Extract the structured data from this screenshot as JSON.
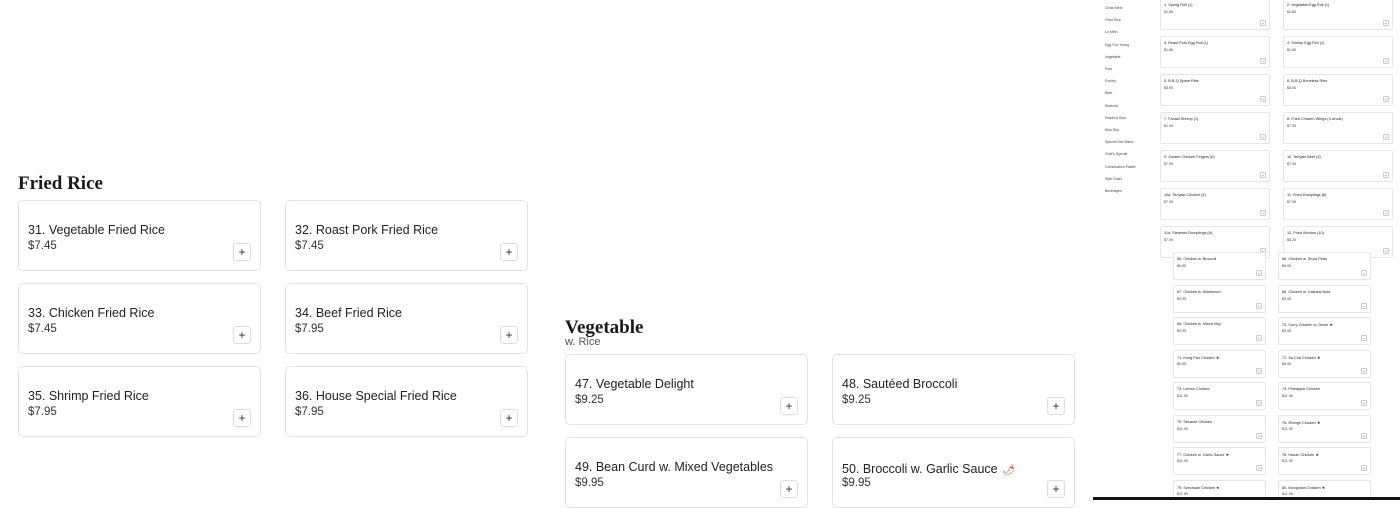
{
  "fried_rice": {
    "title": "Fried Rice",
    "items": [
      {
        "name": "31. Vegetable Fried Rice",
        "price": "$7.45"
      },
      {
        "name": "32. Roast Pork Fried Rice",
        "price": "$7.45"
      },
      {
        "name": "33. Chicken Fried Rice",
        "price": "$7.45"
      },
      {
        "name": "34. Beef Fried Rice",
        "price": "$7.95"
      },
      {
        "name": "35. Shrimp Fried Rice",
        "price": "$7.95"
      },
      {
        "name": "36. House Special Fried Rice",
        "price": "$7.95"
      }
    ]
  },
  "vegetable": {
    "title": "Vegetable",
    "subtitle": "w. Rice",
    "items": [
      {
        "name": "47. Vegetable Delight",
        "price": "$9.25"
      },
      {
        "name": "48. Sautéed Broccoli",
        "price": "$9.25"
      },
      {
        "name": "49. Bean Curd w. Mixed Vegetables",
        "price": "$9.95"
      },
      {
        "name": "50. Broccoli w. Garlic Sauce",
        "price": "$9.95",
        "spicy": true
      }
    ]
  },
  "add_glyph": "+",
  "spicy_glyph": "🌶",
  "mini_categories": [
    "Chow Mein",
    "Fried Rice",
    "Lo Mein",
    "Egg Foo Young",
    "Vegetable",
    "Pork",
    "Poultry",
    "Beef",
    "Seafood",
    "Sweet & Sour",
    "Moo Shu",
    "Special Diet Menu",
    "Chef's Special",
    "Combination Platter",
    "Side Order",
    "Beverages"
  ],
  "mini_appetizers": [
    {
      "name": "1. Spring Roll (1)",
      "price": "$1.85"
    },
    {
      "name": "2. Vegetable Egg Roll (1)",
      "price": "$1.85"
    },
    {
      "name": "3. Roast Pork Egg Roll (1)",
      "price": "$1.85"
    },
    {
      "name": "4. Shrimp Egg Roll (1)",
      "price": "$1.85"
    },
    {
      "name": "5. B-B-Q Spare Ribs",
      "price": "$8.95"
    },
    {
      "name": "6. B-B-Q Boneless Ribs",
      "price": "$8.95"
    },
    {
      "name": "7. Fantail Shrimp (1)",
      "price": "$1.95"
    },
    {
      "name": "8. Fried Chicken Wings (4 whole)",
      "price": "$7.95"
    },
    {
      "name": "9. Golden Chicken Fingers (6)",
      "price": "$7.95"
    },
    {
      "name": "10. Teriyaki Beef (4)",
      "price": "$7.95"
    },
    {
      "name": "10a. Teriyaki Chicken (4)",
      "price": "$7.95"
    },
    {
      "name": "11. Fried Dumplings (8)",
      "price": "$7.95"
    },
    {
      "name": "11a. Steamed Dumplings (8)",
      "price": "$7.95"
    },
    {
      "name": "12. Fried Wonton (10)",
      "price": "$5.25"
    }
  ],
  "mini_poultry": [
    {
      "name": "65. Chicken w. Broccoli",
      "price": "$9.95"
    },
    {
      "name": "66. Chicken w. Snow Peas",
      "price": "$9.95"
    },
    {
      "name": "67. Chicken w. Mushroom",
      "price": "$9.95"
    },
    {
      "name": "68. Chicken w. Cashew Nuts",
      "price": "$9.95"
    },
    {
      "name": "69. Chicken w. Mixed Veg.",
      "price": "$9.95"
    },
    {
      "name": "70. Curry Chicken w. Onion ★",
      "price": "$9.95"
    },
    {
      "name": "71. Kung Pao Chicken ★",
      "price": "$9.95"
    },
    {
      "name": "72. Sa Cha Chicken ★",
      "price": "$9.95"
    },
    {
      "name": "73. Lemon Chicken",
      "price": "$11.95"
    },
    {
      "name": "74. Pineapple Chicken",
      "price": "$11.95"
    },
    {
      "name": "75. Sesame Chicken",
      "price": "$11.95"
    },
    {
      "name": "76. Orange Chicken ★",
      "price": "$11.95"
    },
    {
      "name": "77. Chicken w. Garlic Sauce ★",
      "price": "$11.95"
    },
    {
      "name": "78. Hunan Chicken ★",
      "price": "$11.95"
    },
    {
      "name": "79. Szechuan Chicken ★",
      "price": "$11.95"
    },
    {
      "name": "80. Mongolian Chicken ★",
      "price": "$11.95"
    }
  ]
}
